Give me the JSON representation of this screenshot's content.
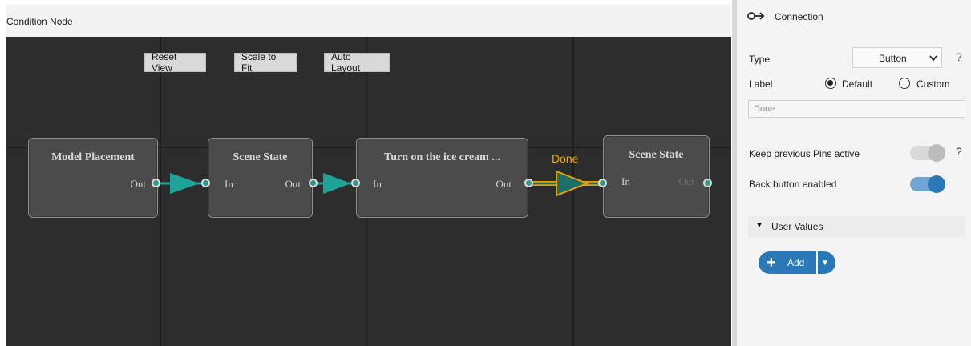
{
  "editor": {
    "title": "Condition Node",
    "toolbar": [
      "Reset View",
      "Scale to Fit",
      "Auto Layout"
    ],
    "nodes": [
      {
        "title": "Model Placement",
        "out": "Out"
      },
      {
        "title": "Scene State",
        "in": "In",
        "out": "Out"
      },
      {
        "title": "Turn on the ice cream ...",
        "in": "In",
        "out": "Out"
      },
      {
        "title": "Scene State",
        "in": "In",
        "out": "Out"
      }
    ],
    "edge_label": "Done",
    "colors": {
      "link": "#21a49a",
      "selected_link": "#f2a000"
    }
  },
  "panel": {
    "header": "Connection",
    "type_label": "Type",
    "type_value": "Button",
    "label_label": "Label",
    "radio_default": "Default",
    "radio_custom": "Custom",
    "label_value": "Done",
    "keep_pins_label": "Keep previous Pins active",
    "back_button_label": "Back button enabled",
    "help": "?",
    "user_values_label": "User Values",
    "add_label": "Add",
    "accent": "#2a78b7"
  }
}
